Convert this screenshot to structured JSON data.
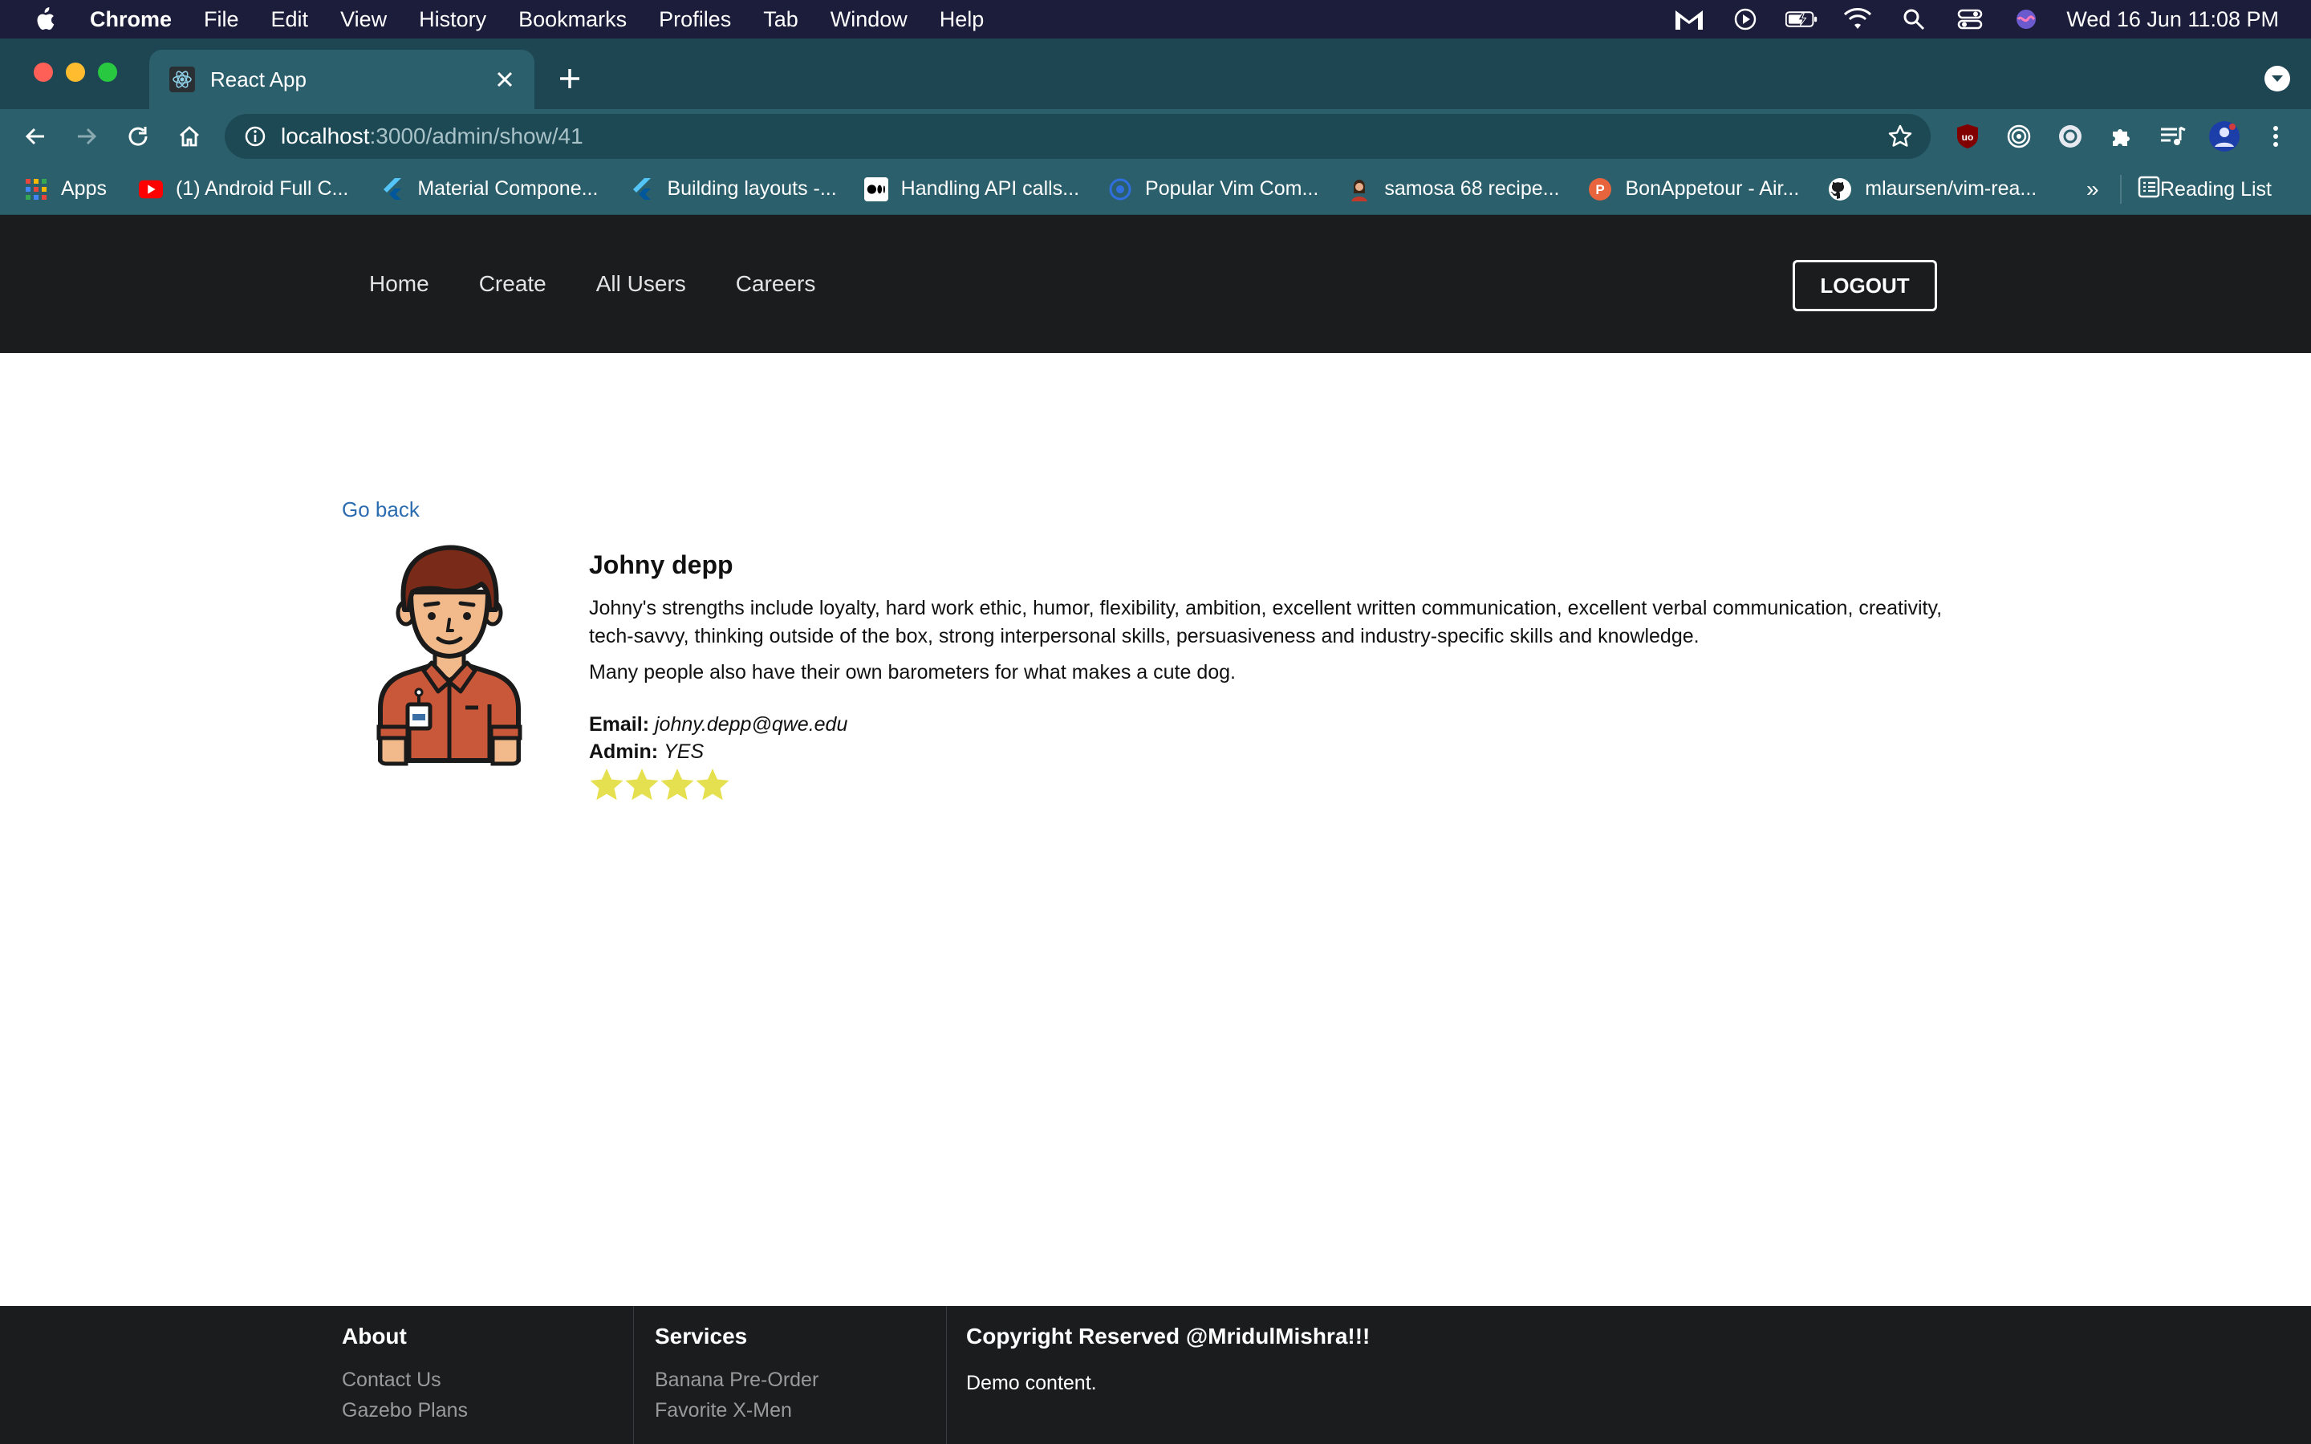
{
  "menubar": {
    "app_name": "Chrome",
    "items": [
      "File",
      "Edit",
      "View",
      "History",
      "Bookmarks",
      "Profiles",
      "Tab",
      "Window",
      "Help"
    ],
    "clock": "Wed 16 Jun  11:08 PM"
  },
  "browser": {
    "tab_title": "React App",
    "url_host": "localhost",
    "url_path": ":3000/admin/show/41",
    "bookmarks": [
      {
        "label": "Apps",
        "icon": "apps-grid-icon",
        "color": "#e8453c"
      },
      {
        "label": "(1) Android Full C...",
        "icon": "youtube-icon",
        "color": "#ff0000"
      },
      {
        "label": "Material Compone...",
        "icon": "flutter-icon",
        "color": "#54c5f8"
      },
      {
        "label": "Building layouts -...",
        "icon": "flutter-icon",
        "color": "#54c5f8"
      },
      {
        "label": "Handling API calls...",
        "icon": "medium-icon",
        "color": "#ffffff"
      },
      {
        "label": "Popular Vim Com...",
        "icon": "site-icon",
        "color": "#2f6fe0"
      },
      {
        "label": "samosa 68 recipe...",
        "icon": "recipe-avatar-icon",
        "color": "#d98c4a"
      },
      {
        "label": "BonAppetour - Air...",
        "icon": "bonappetour-icon",
        "color": "#e8643c"
      },
      {
        "label": "mlaursen/vim-rea...",
        "icon": "github-icon",
        "color": "#ffffff"
      }
    ],
    "bookmarks_more": "»",
    "reading_list": "Reading List"
  },
  "nav": {
    "links": [
      "Home",
      "Create",
      "All Users",
      "Careers"
    ],
    "logout_label": "LOGOUT"
  },
  "profile": {
    "go_back": "Go back",
    "name": "Johny depp",
    "bio": "Johny's strengths include loyalty, hard work ethic, humor, flexibility, ambition, excellent written communication, excellent verbal communication, creativity, tech-savvy, thinking outside of the box, strong interpersonal skills, persuasiveness and industry-specific skills and knowledge.",
    "bio_extra": "Many people also have their own barometers for what makes a cute dog.",
    "email_label": "Email:",
    "email": "johny.depp@qwe.edu",
    "admin_label": "Admin:",
    "admin": "YES",
    "rating": 4,
    "star_color": "#e5e04f"
  },
  "footer": {
    "about": {
      "title": "About",
      "links": [
        "Contact Us",
        "Gazebo Plans"
      ]
    },
    "services": {
      "title": "Services",
      "links": [
        "Banana Pre-Order",
        "Favorite X-Men"
      ]
    },
    "copyright": {
      "title": "Copyright Reserved @MridulMishra!!!",
      "text": "Demo content."
    }
  }
}
